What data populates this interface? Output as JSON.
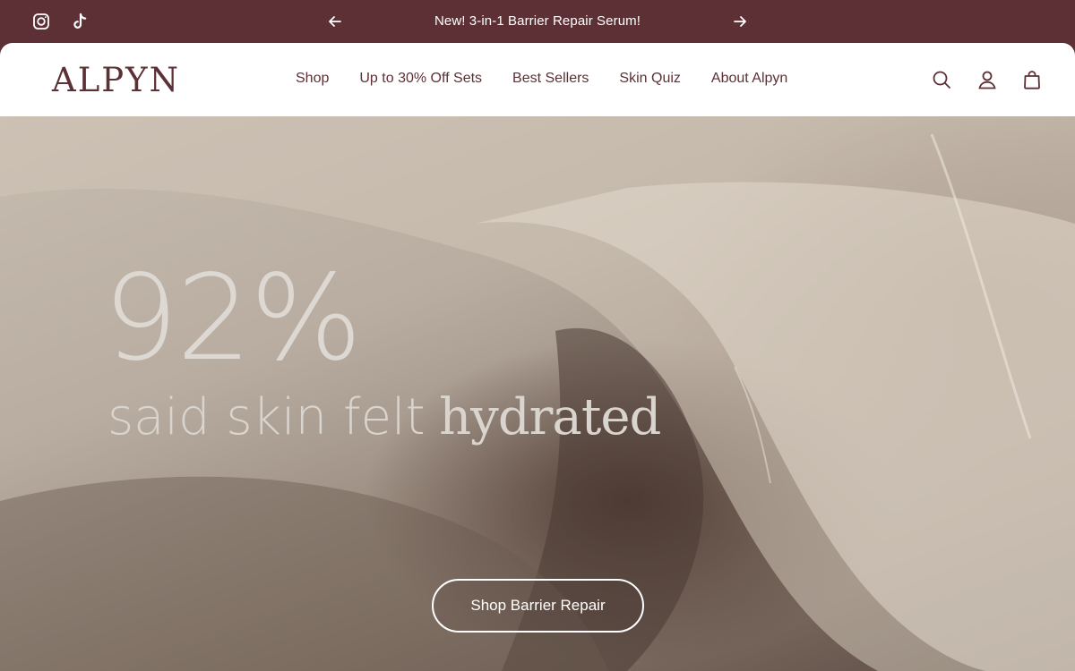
{
  "announcement": {
    "text": "New! 3-in-1 Barrier Repair Serum!",
    "social": [
      "instagram-icon",
      "tiktok-icon"
    ],
    "prev_icon": "arrow-left-icon",
    "next_icon": "arrow-right-icon",
    "background": "#5c3035"
  },
  "header": {
    "logo": "ALPYN",
    "nav": [
      "Shop",
      "Up to 30% Off Sets",
      "Best Sellers",
      "Skin Quiz",
      "About Alpyn"
    ],
    "icons": [
      "search-icon",
      "account-icon",
      "bag-icon"
    ],
    "brand_color": "#5c3035"
  },
  "hero": {
    "stat": "92%",
    "caption_plain": "said skin felt",
    "caption_accent": "hydrated",
    "cta": "Shop Barrier Repair"
  }
}
